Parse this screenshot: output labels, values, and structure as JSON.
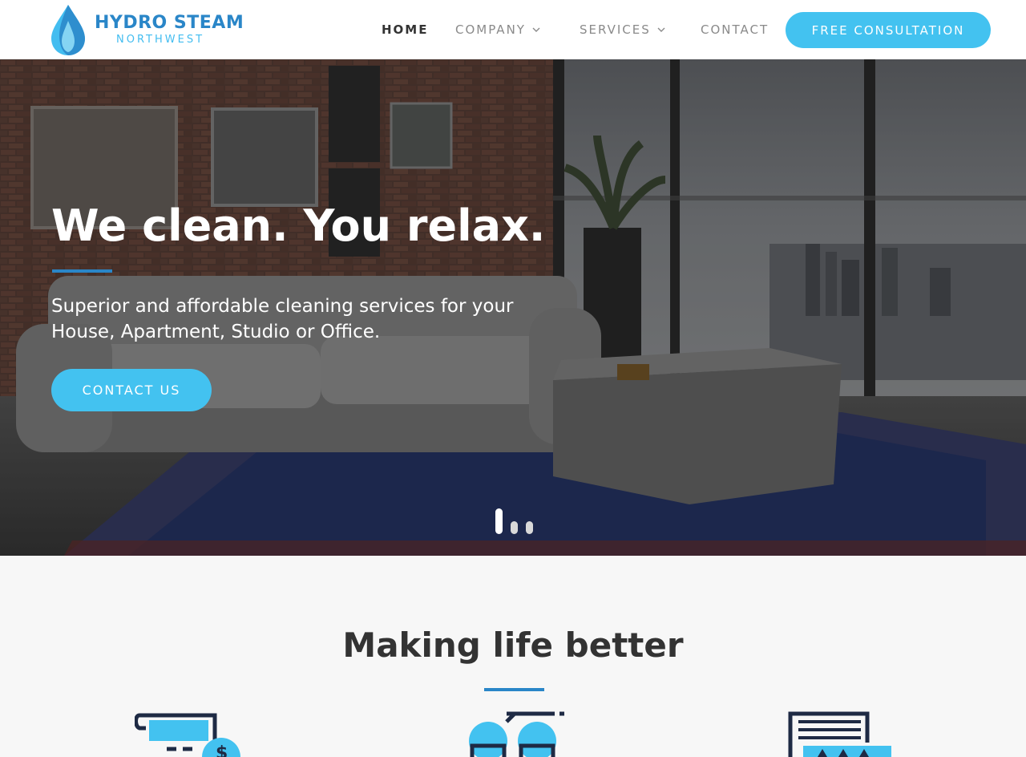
{
  "brand": {
    "title": "HYDRO STEAM",
    "subtitle": "NORTHWEST",
    "primary_color": "#2a86c8",
    "accent_color": "#43c2f0"
  },
  "nav": {
    "home": "HOME",
    "company": "COMPANY",
    "services": "SERVICES",
    "contact": "CONTACT",
    "cta": "FREE CONSULTATION"
  },
  "hero": {
    "title": "We clean. You relax.",
    "subtitle": "Superior and affordable cleaning services for your House, Apartment, Studio or Office.",
    "button": "CONTACT US",
    "slides": [
      {
        "active": true
      },
      {
        "active": false
      },
      {
        "active": false
      }
    ]
  },
  "section": {
    "title": "Making life better",
    "features": [
      {
        "icon": "bill-payment-icon"
      },
      {
        "icon": "team-chat-icon"
      },
      {
        "icon": "document-rating-icon"
      }
    ]
  }
}
